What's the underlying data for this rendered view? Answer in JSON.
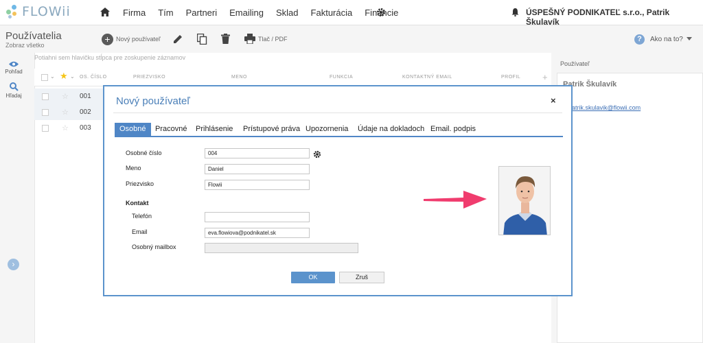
{
  "app": {
    "logo_text": "FLOWii"
  },
  "nav": {
    "items": [
      "Firma",
      "Tím",
      "Partneri",
      "Emailing",
      "Sklad",
      "Fakturácia",
      "Financie"
    ],
    "company": "ÚSPEŠNÝ PODNIKATEĽ s.r.o., Patrik Škulavík"
  },
  "toolbar": {
    "title": "Používatelia",
    "subtitle": "Zobraz všetko",
    "new_user": "Nový používateľ",
    "print": "Tlač / PDF",
    "help": "Ako na to?"
  },
  "rail": {
    "view": "Pohľad",
    "search": "Hľadaj"
  },
  "grid": {
    "group_hint": "Potiahni sem hlavičku stĺpca pre zoskupenie záznamov",
    "columns": [
      "OS. ČÍSLO",
      "PRIEZVISKO",
      "MENO",
      "FUNKCIA",
      "KONTAKTNÝ EMAIL",
      "PROFIL"
    ],
    "rows": [
      "001",
      "002",
      "003"
    ]
  },
  "right_panel": {
    "title": "Používateľ",
    "name": "Patrik Škulavík",
    "email": "patrik.skulavik@flowii.com"
  },
  "modal": {
    "title": "Nový používateľ",
    "close": "×",
    "tabs": [
      "Osobné",
      "Pracovné",
      "Prihlásenie",
      "Prístupové práva",
      "Upozornenia",
      "Údaje na dokladoch",
      "Email. podpis"
    ],
    "active_tab": "Osobné",
    "fields": {
      "personal_number": {
        "label": "Osobné číslo",
        "value": "004"
      },
      "first_name": {
        "label": "Meno",
        "value": "Daniel"
      },
      "last_name": {
        "label": "Priezvisko",
        "value": "Flowii"
      },
      "contact_section": "Kontakt",
      "phone": {
        "label": "Telefón",
        "value": ""
      },
      "email": {
        "label": "Email",
        "value": "eva.flowiova@podnikatel.sk"
      },
      "mailbox": {
        "label": "Osobný mailbox",
        "value": ""
      }
    },
    "ok": "OK",
    "cancel": "Zruš"
  },
  "colors": {
    "accent": "#4f86c6",
    "arrow": "#f03c6e",
    "logo": "#8aa8be"
  },
  "icons": [
    "home-icon",
    "gear-icon",
    "bell-icon",
    "add-icon",
    "pencil-icon",
    "copy-icon",
    "trash-icon",
    "printer-icon",
    "help-icon",
    "eye-icon",
    "search-icon",
    "chevron-right-icon",
    "star-icon",
    "close-icon",
    "settings-gear-icon",
    "arrow-icon"
  ]
}
